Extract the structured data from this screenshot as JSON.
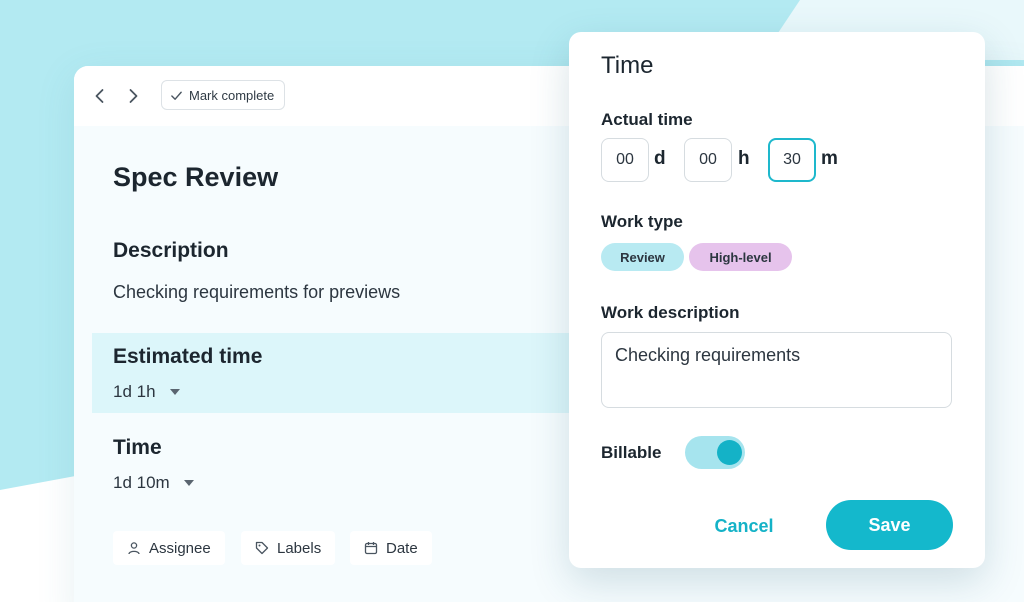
{
  "colors": {
    "accent": "#14b8cc",
    "background_teal": "#b3eaf2",
    "highlight_band": "#dcf6fa",
    "tag_review": "#b8eaf2",
    "tag_high_level": "#e6c3ec"
  },
  "task": {
    "toolbar": {
      "back_icon": "chevron-left-icon",
      "forward_icon": "chevron-right-icon",
      "mark_complete_label": "Mark complete"
    },
    "title": "Spec Review",
    "description_heading": "Description",
    "description_text": "Checking requirements for previews",
    "estimated_heading": "Estimated time",
    "estimated_value": "1d 1h",
    "time_heading": "Time",
    "time_value": "1d 10m",
    "actions": [
      {
        "label": "Assignee",
        "icon": "person-icon"
      },
      {
        "label": "Labels",
        "icon": "tag-icon"
      },
      {
        "label": "Date",
        "icon": "calendar-icon"
      }
    ]
  },
  "time_panel": {
    "title": "Time",
    "actual_time_label": "Actual time",
    "days_value": "00",
    "days_unit": "d",
    "hours_value": "00",
    "hours_unit": "h",
    "minutes_value": "30",
    "minutes_unit": "m",
    "work_type_label": "Work type",
    "work_types": [
      "Review",
      "High-level"
    ],
    "work_description_label": "Work description",
    "work_description_value": "Checking requirements",
    "billable_label": "Billable",
    "billable_on": true,
    "cancel_label": "Cancel",
    "save_label": "Save"
  }
}
